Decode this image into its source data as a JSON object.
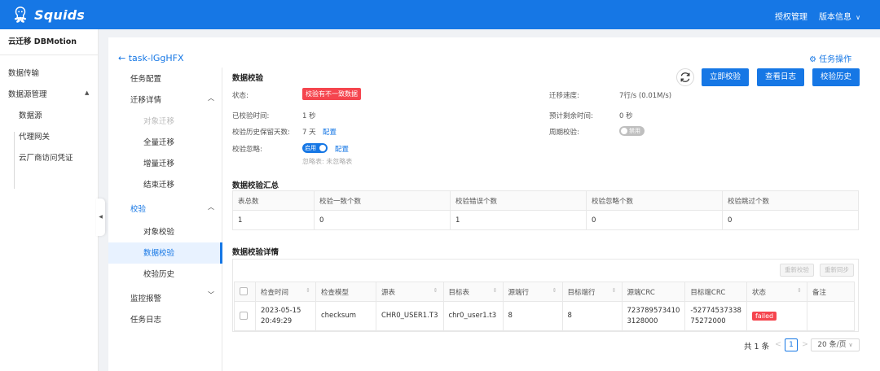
{
  "app": {
    "name": "Squids"
  },
  "header": {
    "auth_mgmt": "授权管理",
    "version_info": "版本信息",
    "version_caret": "∨"
  },
  "sidebar": {
    "title": "云迁移 DBMotion",
    "items": [
      {
        "label": "数据传输"
      },
      {
        "label": "数据源管理"
      }
    ],
    "subitems": [
      {
        "label": "数据源"
      },
      {
        "label": "代理网关"
      },
      {
        "label": "云厂商访问凭证"
      }
    ]
  },
  "task": {
    "back_label": "task-lGgHFX",
    "op_label": "任务操作"
  },
  "menu": {
    "task_config": "任务配置",
    "migration_detail": "迁移详情",
    "object_migration": "对象迁移",
    "full_migration": "全量迁移",
    "incr_migration": "增量迁移",
    "end_migration": "结束迁移",
    "verify": "校验",
    "object_verify": "对象校验",
    "data_verify": "数据校验",
    "verify_history": "校验历史",
    "monitor_alert": "监控报警",
    "task_log": "任务日志"
  },
  "verify": {
    "title": "数据校验",
    "status_label": "状态:",
    "status_value": "校验有不一致数据",
    "elapsed_label": "已校验时间:",
    "elapsed_value": "1 秒",
    "retention_label": "校验历史保留天数:",
    "retention_value": "7 天",
    "config_link": "配置",
    "ignore_label": "校验忽略:",
    "ignore_toggle": "启用",
    "ignore_config": "配置",
    "ignore_table_hint": "忽略表: 未忽略表",
    "speed_label": "迁移速度:",
    "speed_value": "7行/s (0.01M/s)",
    "remaining_label": "预计剩余时间:",
    "remaining_value": "0 秒",
    "periodic_label": "周期校验:",
    "periodic_toggle": "禁用",
    "buttons": {
      "verify_now": "立即校验",
      "view_log": "查看日志",
      "verify_history": "校验历史"
    }
  },
  "summary": {
    "title": "数据校验汇总",
    "columns": [
      "表总数",
      "校验一致个数",
      "校验错误个数",
      "校验忽略个数",
      "校验跳过个数"
    ],
    "row": [
      "1",
      "0",
      "1",
      "0",
      "0"
    ]
  },
  "details": {
    "title": "数据校验详情",
    "reverify_btn": "重新校验",
    "resync_btn": "重新同步",
    "columns": [
      "检查时间",
      "检查模型",
      "源表",
      "目标表",
      "源端行",
      "目标端行",
      "源端CRC",
      "目标端CRC",
      "状态",
      "备注"
    ],
    "rows": [
      {
        "time_line1": "2023-05-15",
        "time_line2": "20:49:29",
        "model": "checksum",
        "source_table": "CHR0_USER1.T3",
        "target_table": "chr0_user1.t3",
        "source_rows": "8",
        "target_rows": "8",
        "source_crc_line1": "723789573410",
        "source_crc_line2": "3128000",
        "target_crc_line1": "-52774537338",
        "target_crc_line2": "75272000",
        "status": "failed",
        "note": ""
      }
    ]
  },
  "pager": {
    "total": "共 1 条",
    "prev": "<",
    "page": "1",
    "next": ">",
    "size": "20 条/页"
  },
  "colors": {
    "primary": "#1677e5",
    "danger": "#f5454e"
  }
}
